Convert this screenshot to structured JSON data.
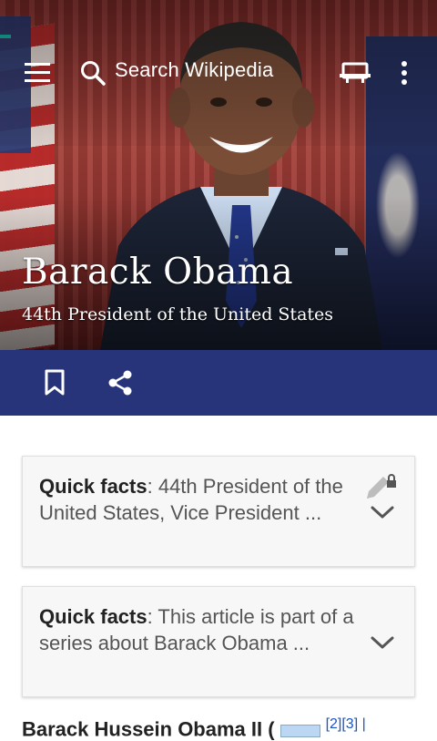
{
  "top_bar": {
    "search_placeholder": "Search Wikipedia",
    "icons": [
      "menu-icon",
      "search-icon",
      "reading-mode-icon",
      "overflow-icon"
    ]
  },
  "article": {
    "title": "Barack Obama",
    "description": "44th President of the United States"
  },
  "action_bar": {
    "icons": [
      "bookmark-icon",
      "share-icon"
    ],
    "color": "#27347a"
  },
  "cards": [
    {
      "label": "Quick facts",
      "text": ": 44th President of the United States, Vice President ..."
    },
    {
      "label": "Quick facts",
      "text": ": This article is part of a series about Barack Obama ..."
    }
  ],
  "section_peek": {
    "text": "Barack Hussein Obama II (",
    "refs": "[2][3] |"
  },
  "colors": {
    "accent": "#18b7a6",
    "link": "#1a55c6"
  }
}
